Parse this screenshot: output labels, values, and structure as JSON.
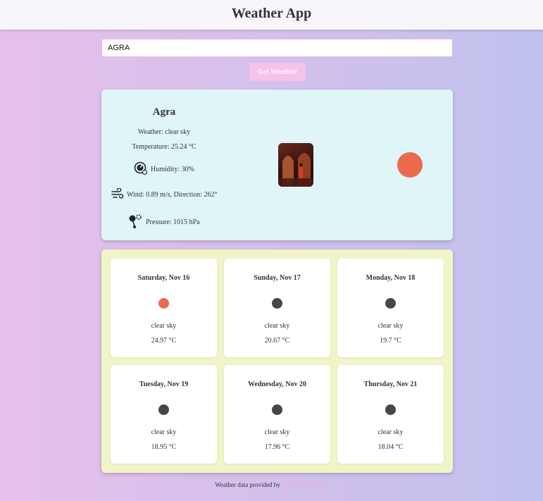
{
  "header": {
    "title": "Weather App"
  },
  "search": {
    "value": "AGRA",
    "button_label": "Get Weather"
  },
  "current": {
    "city": "Agra",
    "weather": "Weather: clear sky",
    "temperature": "Temperature: 25.24 °C",
    "humidity": "Humidity: 30%",
    "wind": "Wind: 0.89 m/s, Direction: 262°",
    "pressure": "Pressure: 1015 hPa",
    "sun_color": "#ea6a4e"
  },
  "forecast": [
    {
      "day": "Saturday, Nov 16",
      "desc": "clear sky",
      "temp": "24.97 °C"
    },
    {
      "day": "Sunday, Nov 17",
      "desc": "clear sky",
      "temp": "20.67 °C"
    },
    {
      "day": "Monday, Nov 18",
      "desc": "clear sky",
      "temp": "19.7 °C"
    },
    {
      "day": "Tuesday, Nov 19",
      "desc": "clear sky",
      "temp": "18.95 °C"
    },
    {
      "day": "Wednesday, Nov 20",
      "desc": "clear sky",
      "temp": "17.96 °C"
    },
    {
      "day": "Thursday, Nov 21",
      "desc": "clear sky",
      "temp": "18.04 °C"
    }
  ],
  "footer": {
    "text": "Weather data provided by",
    "link_label": "OpenWeatherMap"
  },
  "colors": {
    "accent": "#f5c2ea",
    "card_bg": "#dff5f8",
    "forecast_bg": "#f1f4c6"
  }
}
